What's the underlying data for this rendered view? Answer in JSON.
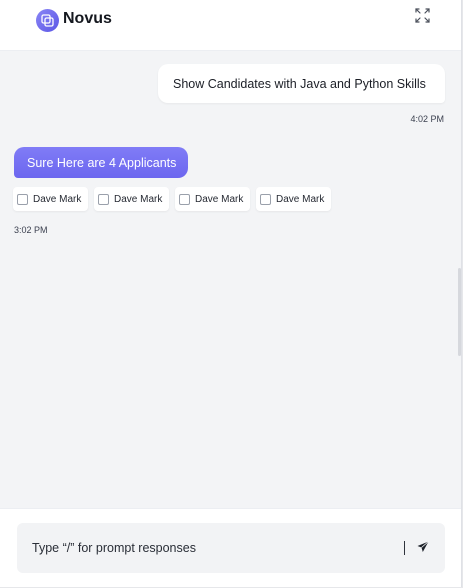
{
  "header": {
    "brand": "Novus",
    "logo_icon": "cube-icon",
    "expand_icon": "expand-icon"
  },
  "conversation": {
    "user_message": "Show Candidates with Java and Python Skills",
    "user_time": "4:02 PM",
    "bot_message": "Sure Here are 4 Applicants",
    "bot_time": "3:02 PM",
    "applicants": [
      {
        "name": "Dave Mark",
        "checked": false
      },
      {
        "name": "Dave Mark",
        "checked": false
      },
      {
        "name": "Dave Mark",
        "checked": false
      },
      {
        "name": "Dave Mark",
        "checked": false
      }
    ]
  },
  "composer": {
    "placeholder": "Type “/” for prompt responses",
    "send_icon": "send-icon"
  },
  "colors": {
    "accent": "#6f6af0",
    "background": "#f3f4f6"
  }
}
